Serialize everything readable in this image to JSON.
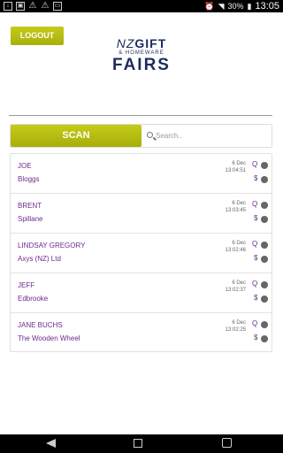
{
  "status_bar": {
    "battery": "30%",
    "time": "13:05"
  },
  "header": {
    "logout_label": "LOGOUT",
    "logo": {
      "line1_nz": "NZ",
      "line1_gift": "GIFT",
      "line2": "& HOMEWARE",
      "line3": "FAIRS"
    }
  },
  "toolbar": {
    "scan_label": "SCAN",
    "search_placeholder": "Search.."
  },
  "contacts": [
    {
      "first": "JOE",
      "last": "Bloggs",
      "date": "6 Dec",
      "time": "13:04:51"
    },
    {
      "first": "BRENT",
      "last": "Spillane",
      "date": "6 Dec",
      "time": "13:03:45"
    },
    {
      "first": "LINDSAY GREGORY",
      "last": "Axys (NZ) Ltd",
      "date": "6 Dec",
      "time": "13:02:46"
    },
    {
      "first": "JEFF",
      "last": "Edbrooke",
      "date": "6 Dec",
      "time": "13:02:37"
    },
    {
      "first": "JANE BUCHS",
      "last": "The Wooden Wheel",
      "date": "6 Dec",
      "time": "13:02:25"
    }
  ],
  "icons": {
    "q": "Q",
    "dollar": "$"
  },
  "colors": {
    "accent": "#b5bd12",
    "text_primary": "#6e2a8c",
    "status_dot": "#666666"
  }
}
